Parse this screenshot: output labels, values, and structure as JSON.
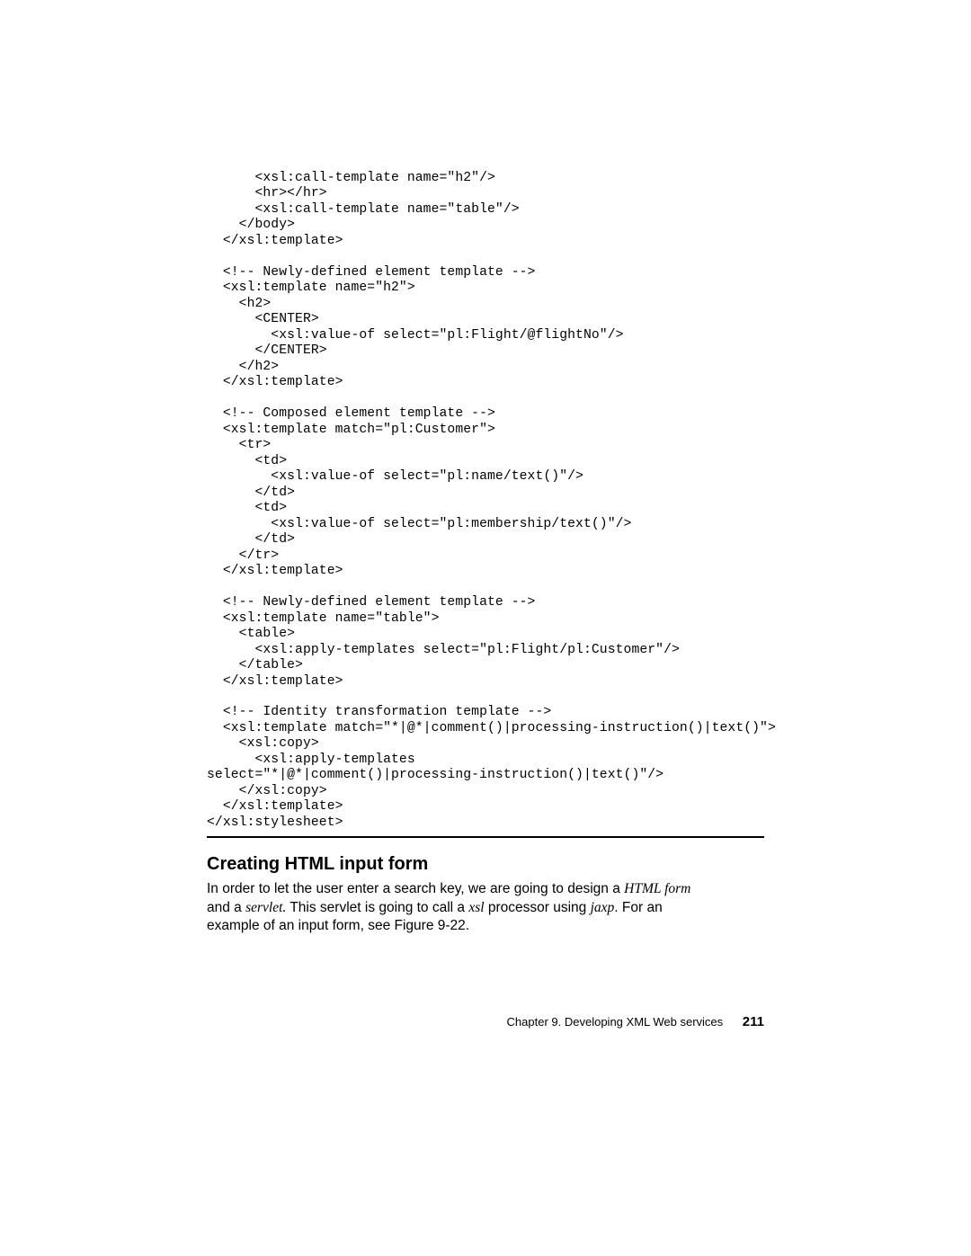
{
  "code": {
    "lines": [
      "      <xsl:call-template name=\"h2\"/>",
      "      <hr></hr>",
      "      <xsl:call-template name=\"table\"/>",
      "    </body>",
      "  </xsl:template>",
      "",
      "  <!-- Newly-defined element template -->",
      "  <xsl:template name=\"h2\">",
      "    <h2>",
      "      <CENTER>",
      "        <xsl:value-of select=\"pl:Flight/@flightNo\"/>",
      "      </CENTER>",
      "    </h2>",
      "  </xsl:template>",
      "",
      "  <!-- Composed element template -->",
      "  <xsl:template match=\"pl:Customer\">",
      "    <tr>",
      "      <td>",
      "        <xsl:value-of select=\"pl:name/text()\"/>",
      "      </td>",
      "      <td>",
      "        <xsl:value-of select=\"pl:membership/text()\"/>",
      "      </td>",
      "    </tr>",
      "  </xsl:template>",
      "",
      "  <!-- Newly-defined element template -->",
      "  <xsl:template name=\"table\">",
      "    <table>",
      "      <xsl:apply-templates select=\"pl:Flight/pl:Customer\"/>",
      "    </table>",
      "  </xsl:template>",
      "",
      "  <!-- Identity transformation template -->",
      "  <xsl:template match=\"*|@*|comment()|processing-instruction()|text()\">",
      "    <xsl:copy>",
      "      <xsl:apply-templates",
      "select=\"*|@*|comment()|processing-instruction()|text()\"/>",
      "    </xsl:copy>",
      "  </xsl:template>",
      "</xsl:stylesheet>"
    ]
  },
  "heading": "Creating HTML input form",
  "para": {
    "p1a": "In order to let the user enter a search key, we are going to design a ",
    "p1b_html_form": "HTML form",
    "p2a": "and a ",
    "p2b_servlet": "servlet.",
    "p2c": " This servlet is going to call a ",
    "p2d_xsl": "xsl",
    "p2e": " processor using ",
    "p2f_jaxp": "jaxp",
    "p2g": ". For an",
    "p3": "example of an input form, see Figure 9-22."
  },
  "footer": {
    "chapter": "Chapter 9. Developing XML Web services",
    "page": "211"
  }
}
